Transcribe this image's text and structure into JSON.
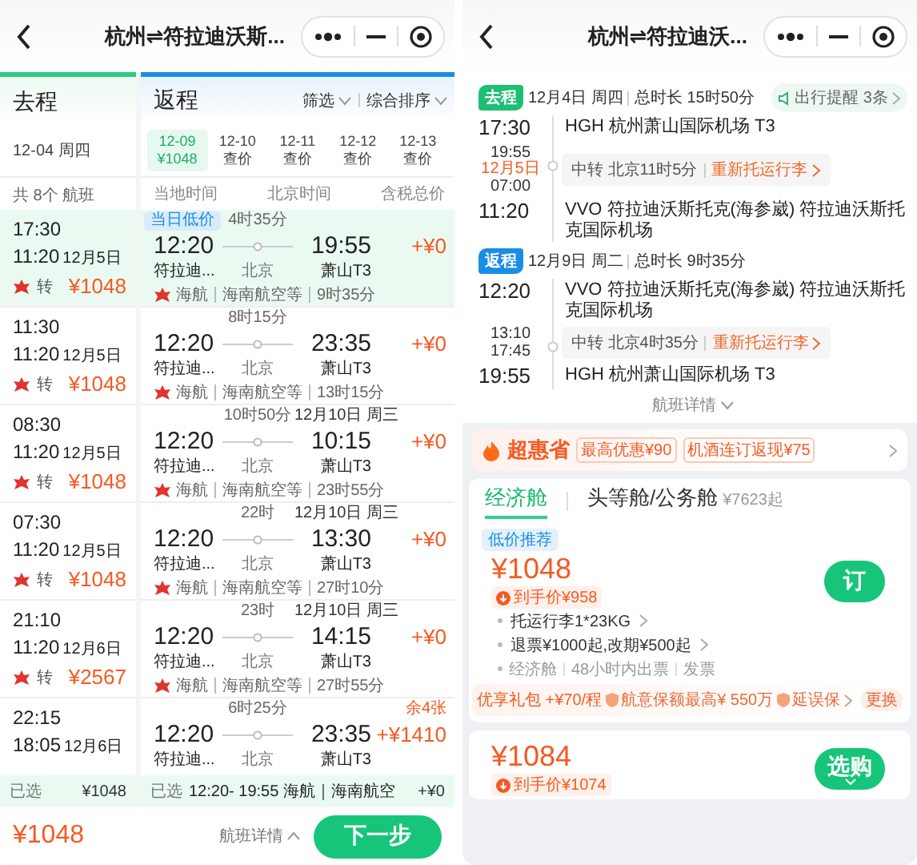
{
  "left_screen": {
    "header": {
      "title": "杭州⇌符拉迪沃斯..."
    },
    "outbound": {
      "title": "去程",
      "date": "12-04 周四",
      "count": "共 8个 航班",
      "flights": [
        {
          "dep": "17:30",
          "arr": "11:20",
          "arr_date": "12月5日",
          "transfer": "转",
          "price": "¥1048",
          "selected": true
        },
        {
          "dep": "11:30",
          "arr": "11:20",
          "arr_date": "12月5日",
          "transfer": "转",
          "price": "¥1048",
          "selected": false
        },
        {
          "dep": "08:30",
          "arr": "11:20",
          "arr_date": "12月5日",
          "transfer": "转",
          "price": "¥1048",
          "selected": false
        },
        {
          "dep": "07:30",
          "arr": "11:20",
          "arr_date": "12月5日",
          "transfer": "转",
          "price": "¥1048",
          "selected": false
        },
        {
          "dep": "21:10",
          "arr": "11:20",
          "arr_date": "12月6日",
          "transfer": "转",
          "price": "¥2567",
          "selected": false
        },
        {
          "dep": "22:15",
          "arr": "18:05",
          "arr_date": "12月6日",
          "selected": false
        }
      ],
      "chosen": {
        "label": "已选",
        "price": "¥1048"
      }
    },
    "return": {
      "title": "返程",
      "filter": "筛选",
      "sort": "综合排序",
      "dates": [
        {
          "date": "12-09",
          "price": "¥1048",
          "selected": true
        },
        {
          "date": "12-10",
          "price": "查价",
          "selected": false
        },
        {
          "date": "12-11",
          "price": "查价",
          "selected": false
        },
        {
          "date": "12-12",
          "price": "查价",
          "selected": false
        },
        {
          "date": "12-13",
          "price": "查价",
          "selected": false
        }
      ],
      "columns": [
        "当地时间",
        "北京时间",
        "含税总价"
      ],
      "flights": [
        {
          "badge": "当日低价",
          "dep": "12:20",
          "duration": "4时35分",
          "via": "北京",
          "arr": "19:55",
          "dep_airport": "符拉迪...",
          "arr_airport": "萧山T3",
          "price": "+¥0",
          "airline": "海航",
          "carriers": "海南航空等",
          "total": "9时35分",
          "selected": true
        },
        {
          "dep": "12:20",
          "duration": "8时15分",
          "via": "北京",
          "arr": "23:35",
          "dep_airport": "符拉迪...",
          "arr_airport": "萧山T3",
          "price": "+¥0",
          "airline": "海航",
          "carriers": "海南航空等",
          "total": "13时15分",
          "selected": false
        },
        {
          "dep": "12:20",
          "duration": "10时50分",
          "via": "北京",
          "arr_date": "12月10日 周三",
          "arr": "10:15",
          "dep_airport": "符拉迪...",
          "arr_airport": "萧山T3",
          "price": "+¥0",
          "airline": "海航",
          "carriers": "海南航空等",
          "total": "23时55分",
          "selected": false
        },
        {
          "dep": "12:20",
          "duration": "22时",
          "via": "北京",
          "arr_date": "12月10日 周三",
          "arr": "13:30",
          "dep_airport": "符拉迪...",
          "arr_airport": "萧山T3",
          "price": "+¥0",
          "airline": "海航",
          "carriers": "海南航空等",
          "total": "27时10分",
          "selected": false
        },
        {
          "dep": "12:20",
          "duration": "23时",
          "via": "北京",
          "arr_date": "12月10日 周三",
          "arr": "14:15",
          "dep_airport": "符拉迪...",
          "arr_airport": "萧山T3",
          "price": "+¥0",
          "airline": "海航",
          "carriers": "海南航空等",
          "total": "27时55分",
          "selected": false
        },
        {
          "dep": "12:20",
          "duration": "6时25分",
          "via": "北京",
          "arr": "23:35",
          "dep_airport": "符拉迪...",
          "arr_airport": "萧山T3",
          "price_note": "余4张",
          "price": "+¥1410",
          "selected": false
        }
      ],
      "chosen": {
        "label": "已选",
        "summary": "12:20- 19:55 海航｜海南航空",
        "price": "+¥0"
      }
    },
    "bottom_bar": {
      "price": "¥1048",
      "details": "航班详情",
      "next": "下一步"
    }
  },
  "right_screen": {
    "header": {
      "title": "杭州⇌符拉迪沃..."
    },
    "reminder": "出行提醒 3条",
    "legs": [
      {
        "tag": "去程",
        "color": "#1dbf73",
        "date": "12月4日 周四",
        "total": "总时长 15时50分",
        "dep_time": "17:30",
        "dep_airport": "HGH 杭州萧山国际机场 T3",
        "stop_arr": "19:55",
        "stop_date": "12月5日",
        "stop_dep": "07:00",
        "transfer": "中转 北京11时5分",
        "rebook": "重新托运行李",
        "arr_time": "11:20",
        "arr_airport": "VVO 符拉迪沃斯托克(海参崴) 符拉迪沃斯托克国际机场"
      },
      {
        "tag": "返程",
        "color": "#1a8ee6",
        "date": "12月9日 周二",
        "total": "总时长 9时35分",
        "dep_time": "12:20",
        "dep_airport": "VVO 符拉迪沃斯托克(海参崴) 符拉迪沃斯托克国际机场",
        "stop_arr": "13:10",
        "stop_dep": "17:45",
        "transfer": "中转 北京4时35分",
        "rebook": "重新托运行李",
        "arr_time": "19:55",
        "arr_airport": "HGH 杭州萧山国际机场 T3"
      }
    ],
    "details": "航班详情",
    "promo": {
      "title": "超惠省",
      "tags": [
        "最高优惠¥90",
        "机酒连订返现¥75"
      ]
    },
    "cabins": [
      {
        "label": "经济舱",
        "selected": true
      },
      {
        "label": "头等舱/公务舱",
        "price": "¥7623起",
        "selected": false
      }
    ],
    "offers": [
      {
        "badge": "低价推荐",
        "price": "¥1048",
        "net_price": "到手价¥958",
        "features": [
          "托运行李1*23KG",
          "退票¥1000起,改期¥500起"
        ],
        "notes": [
          "经济舱",
          "48小时内出票",
          "发票"
        ],
        "gift": {
          "title": "优享礼包 +¥70/程",
          "items": [
            "航意保额最高¥ 550万",
            "延误保"
          ],
          "change": "更换"
        },
        "button": "订"
      },
      {
        "price": "¥1084",
        "net_price": "到手价¥1074",
        "button": "选购"
      }
    ]
  }
}
